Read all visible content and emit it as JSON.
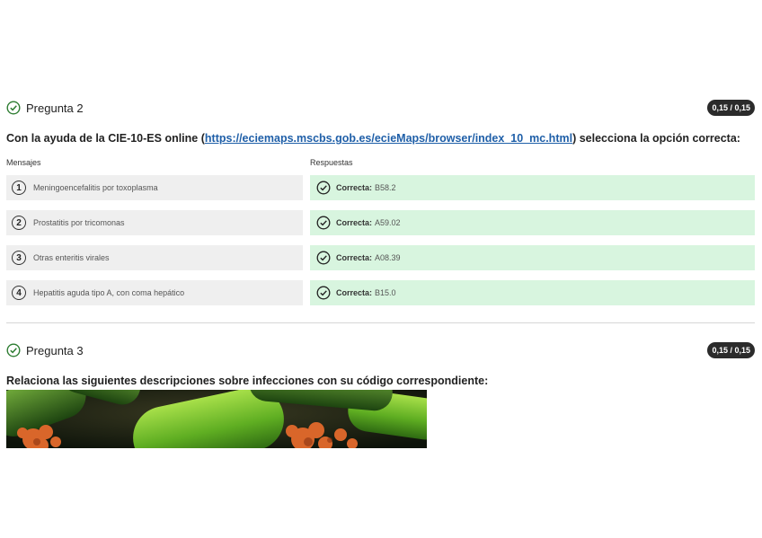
{
  "question2": {
    "title": "Pregunta 2",
    "score": "0,15 / 0,15",
    "prompt_before": "Con la ayuda de la CIE-10-ES online (",
    "prompt_link": "https://eciemaps.mscbs.gob.es/ecieMaps/browser/index_10_mc.html",
    "prompt_after": ") selecciona la opción correcta:",
    "messages_label": "Mensajes",
    "responses_label": "Respuestas",
    "rows": [
      {
        "number": "1",
        "message": "Meningoencefalitis por toxoplasma",
        "answer_label": "Correcta:",
        "answer_value": "B58.2"
      },
      {
        "number": "2",
        "message": "Prostatitis por tricomonas",
        "answer_label": "Correcta:",
        "answer_value": "A59.02"
      },
      {
        "number": "3",
        "message": "Otras enteritis virales",
        "answer_label": "Correcta:",
        "answer_value": "A08.39"
      },
      {
        "number": "4",
        "message": "Hepatitis aguda tipo A, con coma hepático",
        "answer_label": "Correcta:",
        "answer_value": "B15.0"
      }
    ]
  },
  "question3": {
    "title": "Pregunta 3",
    "score": "0,15 / 0,15",
    "prompt": "Relaciona las siguientes descripciones sobre infecciones con su código correspondiente:"
  },
  "colors": {
    "success_bg": "#d8f5df",
    "check_green": "#2e7d32",
    "badge_bg": "#2b2b2b",
    "link": "#1f5fa8"
  }
}
